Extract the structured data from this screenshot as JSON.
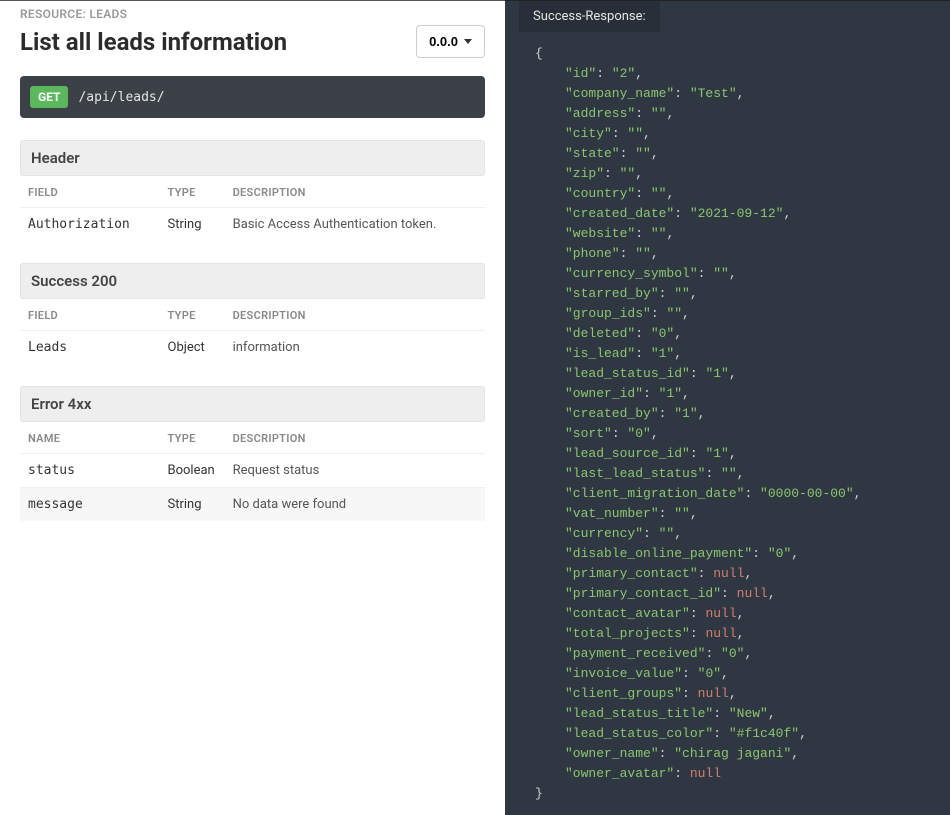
{
  "resource_label": "RESOURCE: LEADS",
  "page_title": "List all leads information",
  "version_label": "0.0.0",
  "endpoint": {
    "method": "GET",
    "path": "/api/leads/"
  },
  "sections": {
    "header": {
      "title": "Header",
      "columns": {
        "field": "FIELD",
        "type": "TYPE",
        "desc": "DESCRIPTION"
      },
      "rows": [
        {
          "field": "Authorization",
          "type": "String",
          "desc": "Basic Access Authentication token."
        }
      ]
    },
    "success": {
      "title": "Success 200",
      "columns": {
        "field": "FIELD",
        "type": "TYPE",
        "desc": "DESCRIPTION"
      },
      "rows": [
        {
          "field": "Leads",
          "type": "Object",
          "desc": "information"
        }
      ]
    },
    "error": {
      "title": "Error 4xx",
      "columns": {
        "field": "NAME",
        "type": "TYPE",
        "desc": "DESCRIPTION"
      },
      "rows": [
        {
          "field": "status",
          "type": "Boolean",
          "desc": "Request status"
        },
        {
          "field": "message",
          "type": "String",
          "desc": "No data were found"
        }
      ]
    }
  },
  "response_tab_label": "Success-Response:",
  "response_json": [
    {
      "key": "id",
      "value": "2",
      "type": "str"
    },
    {
      "key": "company_name",
      "value": "Test",
      "type": "str"
    },
    {
      "key": "address",
      "value": "",
      "type": "str"
    },
    {
      "key": "city",
      "value": "",
      "type": "str"
    },
    {
      "key": "state",
      "value": "",
      "type": "str"
    },
    {
      "key": "zip",
      "value": "",
      "type": "str"
    },
    {
      "key": "country",
      "value": "",
      "type": "str"
    },
    {
      "key": "created_date",
      "value": "2021-09-12",
      "type": "str"
    },
    {
      "key": "website",
      "value": "",
      "type": "str"
    },
    {
      "key": "phone",
      "value": "",
      "type": "str"
    },
    {
      "key": "currency_symbol",
      "value": "",
      "type": "str"
    },
    {
      "key": "starred_by",
      "value": "",
      "type": "str"
    },
    {
      "key": "group_ids",
      "value": "",
      "type": "str"
    },
    {
      "key": "deleted",
      "value": "0",
      "type": "str"
    },
    {
      "key": "is_lead",
      "value": "1",
      "type": "str"
    },
    {
      "key": "lead_status_id",
      "value": "1",
      "type": "str"
    },
    {
      "key": "owner_id",
      "value": "1",
      "type": "str"
    },
    {
      "key": "created_by",
      "value": "1",
      "type": "str"
    },
    {
      "key": "sort",
      "value": "0",
      "type": "str"
    },
    {
      "key": "lead_source_id",
      "value": "1",
      "type": "str"
    },
    {
      "key": "last_lead_status",
      "value": "",
      "type": "str"
    },
    {
      "key": "client_migration_date",
      "value": "0000-00-00",
      "type": "str"
    },
    {
      "key": "vat_number",
      "value": "",
      "type": "str"
    },
    {
      "key": "currency",
      "value": "",
      "type": "str"
    },
    {
      "key": "disable_online_payment",
      "value": "0",
      "type": "str"
    },
    {
      "key": "primary_contact",
      "value": null,
      "type": "null"
    },
    {
      "key": "primary_contact_id",
      "value": null,
      "type": "null"
    },
    {
      "key": "contact_avatar",
      "value": null,
      "type": "null"
    },
    {
      "key": "total_projects",
      "value": null,
      "type": "null"
    },
    {
      "key": "payment_received",
      "value": "0",
      "type": "str"
    },
    {
      "key": "invoice_value",
      "value": "0",
      "type": "str"
    },
    {
      "key": "client_groups",
      "value": null,
      "type": "null"
    },
    {
      "key": "lead_status_title",
      "value": "New",
      "type": "str"
    },
    {
      "key": "lead_status_color",
      "value": "#f1c40f",
      "type": "str"
    },
    {
      "key": "owner_name",
      "value": "chirag jagani",
      "type": "str"
    },
    {
      "key": "owner_avatar",
      "value": null,
      "type": "null",
      "last": true
    }
  ]
}
